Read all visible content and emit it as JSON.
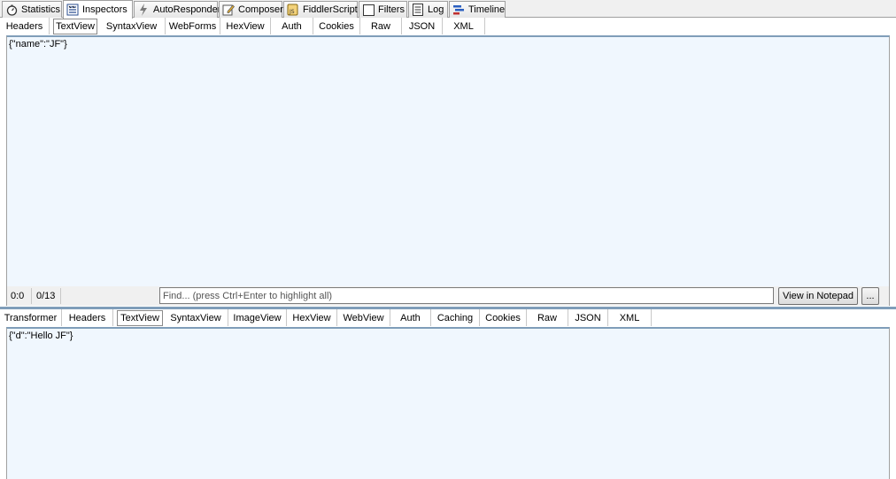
{
  "main_tabs": [
    {
      "label": "Statistics",
      "icon": "stopwatch-icon"
    },
    {
      "label": "Inspectors",
      "icon": "inspector-icon"
    },
    {
      "label": "AutoResponder",
      "icon": "lightning-icon"
    },
    {
      "label": "Composer",
      "icon": "pencil-icon"
    },
    {
      "label": "FiddlerScript",
      "icon": "script-icon"
    },
    {
      "label": "Filters",
      "icon": "checkbox-icon"
    },
    {
      "label": "Log",
      "icon": "log-icon"
    },
    {
      "label": "Timeline",
      "icon": "timeline-icon"
    }
  ],
  "request": {
    "tabs": [
      "Headers",
      "TextView",
      "SyntaxView",
      "WebForms",
      "HexView",
      "Auth",
      "Cookies",
      "Raw",
      "JSON",
      "XML"
    ],
    "active_tab": "TextView",
    "body": "{\"name\":\"JF\"}"
  },
  "status": {
    "position": "0:0",
    "count": "0/13",
    "find_placeholder": "Find... (press Ctrl+Enter to highlight all)",
    "view_button": "View in Notepad",
    "more_button": "..."
  },
  "response": {
    "tabs": [
      "Transformer",
      "Headers",
      "TextView",
      "SyntaxView",
      "ImageView",
      "HexView",
      "WebView",
      "Auth",
      "Caching",
      "Cookies",
      "Raw",
      "JSON",
      "XML"
    ],
    "active_tab": "TextView",
    "body": "{\"d\":\"Hello JF\"}"
  },
  "colors": {
    "pane_background": "#f0f7fe",
    "splitter": "#7f9db9"
  }
}
